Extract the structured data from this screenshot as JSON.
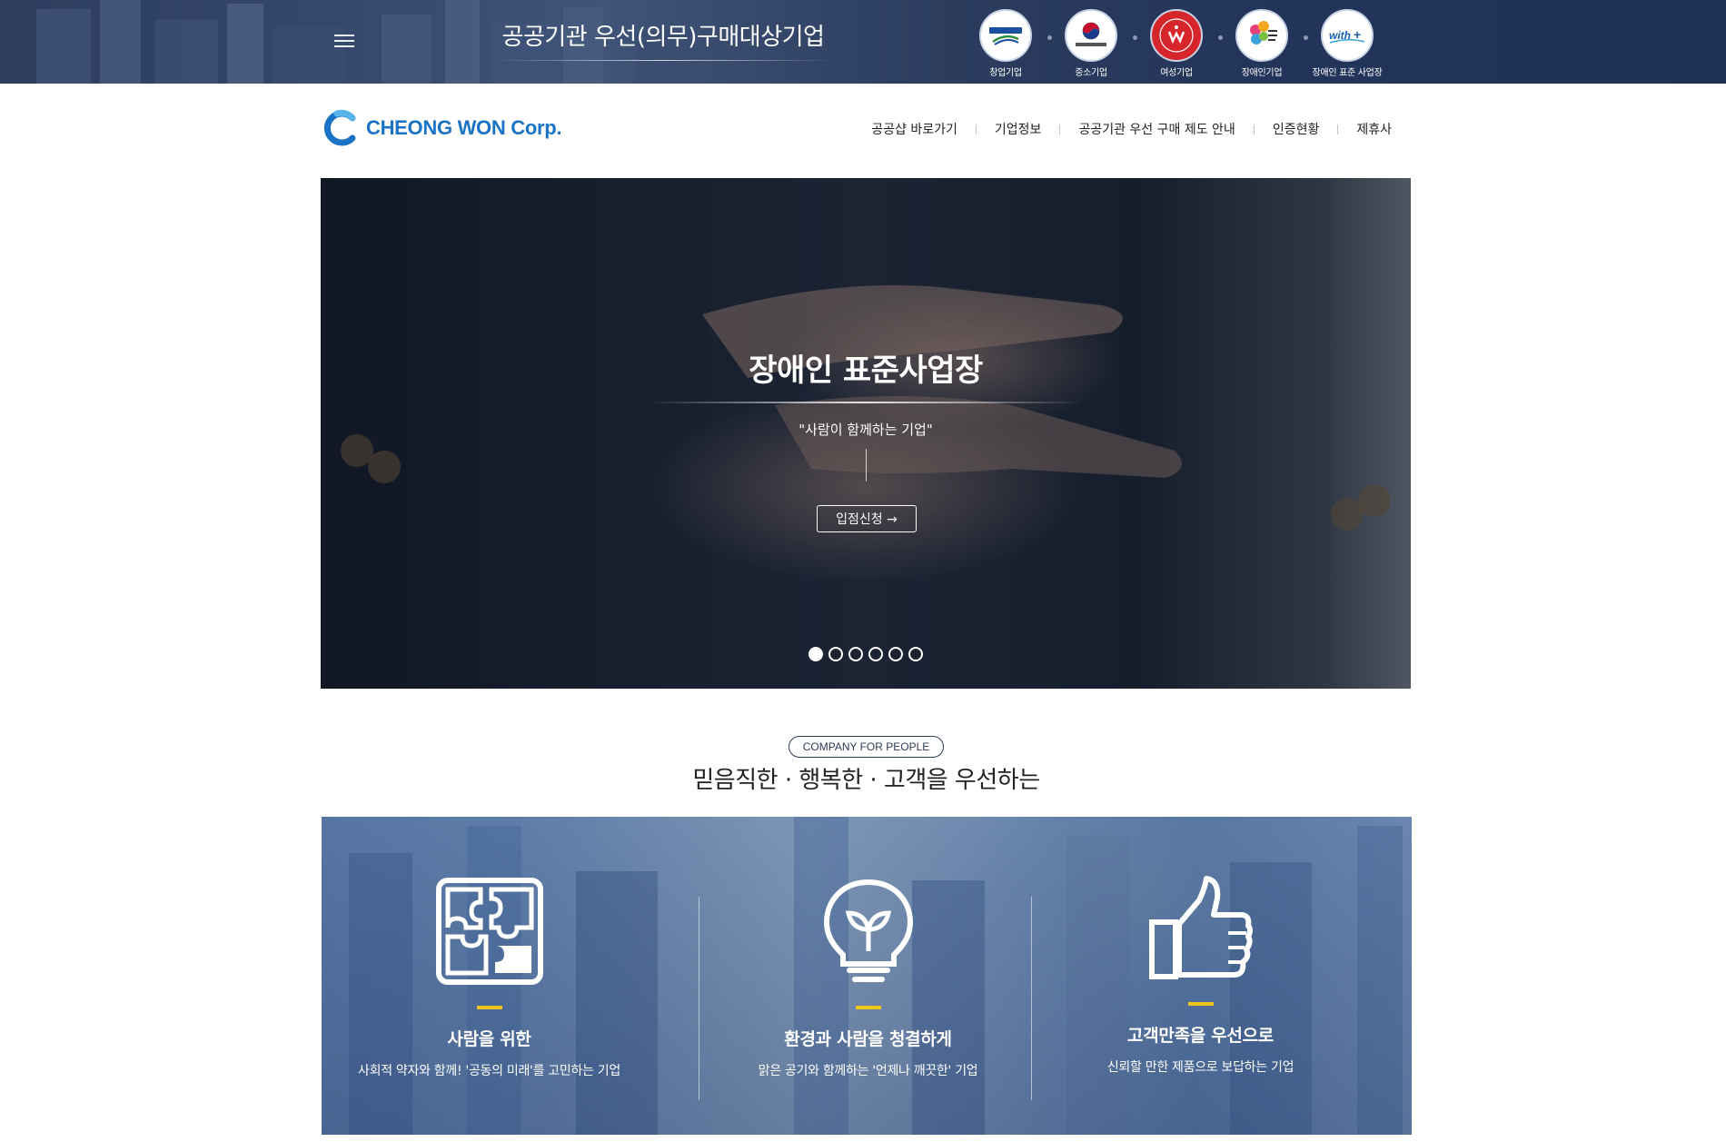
{
  "top_banner": {
    "title": "공공기관 우선(의무)구매대상기업",
    "certs": [
      {
        "label": "창업기업",
        "icon": "startup-company-badge"
      },
      {
        "label": "중소기업",
        "icon": "sme-badge"
      },
      {
        "label": "여성기업",
        "icon": "women-enterprise-badge"
      },
      {
        "label": "장애인기업",
        "icon": "disabled-enterprise-badge"
      },
      {
        "label": "장애인 표준 사업장",
        "icon": "with-plus-badge"
      }
    ]
  },
  "header": {
    "logo_text": "CHEONG WON Corp.",
    "nav": [
      "공공샵 바로가기",
      "기업정보",
      "공공기관 우선 구매 제도 안내",
      "인증현황",
      "제휴사"
    ]
  },
  "hero": {
    "title": "장애인 표준사업장",
    "subtitle": "\"사람이 함께하는 기업\"",
    "button_label": "입점신청 →",
    "slide_count": 6,
    "active_slide": 1
  },
  "intro": {
    "pill": "COMPANY FOR PEOPLE",
    "headline": "믿음직한 · 행복한 · 고객을 우선하는"
  },
  "features": [
    {
      "icon": "puzzle-icon",
      "title": "사람을 위한",
      "desc": "사회적 약자와 함께! '공동의 미래'를 고민하는 기업"
    },
    {
      "icon": "lightbulb-sprout-icon",
      "title": "환경과 사람을 청결하게",
      "desc": "맑은 공기와 함께하는 '언제나 깨끗한' 기업"
    },
    {
      "icon": "thumbs-up-icon",
      "title": "고객만족을 우선으로",
      "desc": "신뢰할 만한 제품으로 보답하는 기업"
    }
  ],
  "colors": {
    "accent_blue": "#1a73c4",
    "feature_bar": "#f0c419",
    "banner_dark": "#2c3d5e"
  }
}
